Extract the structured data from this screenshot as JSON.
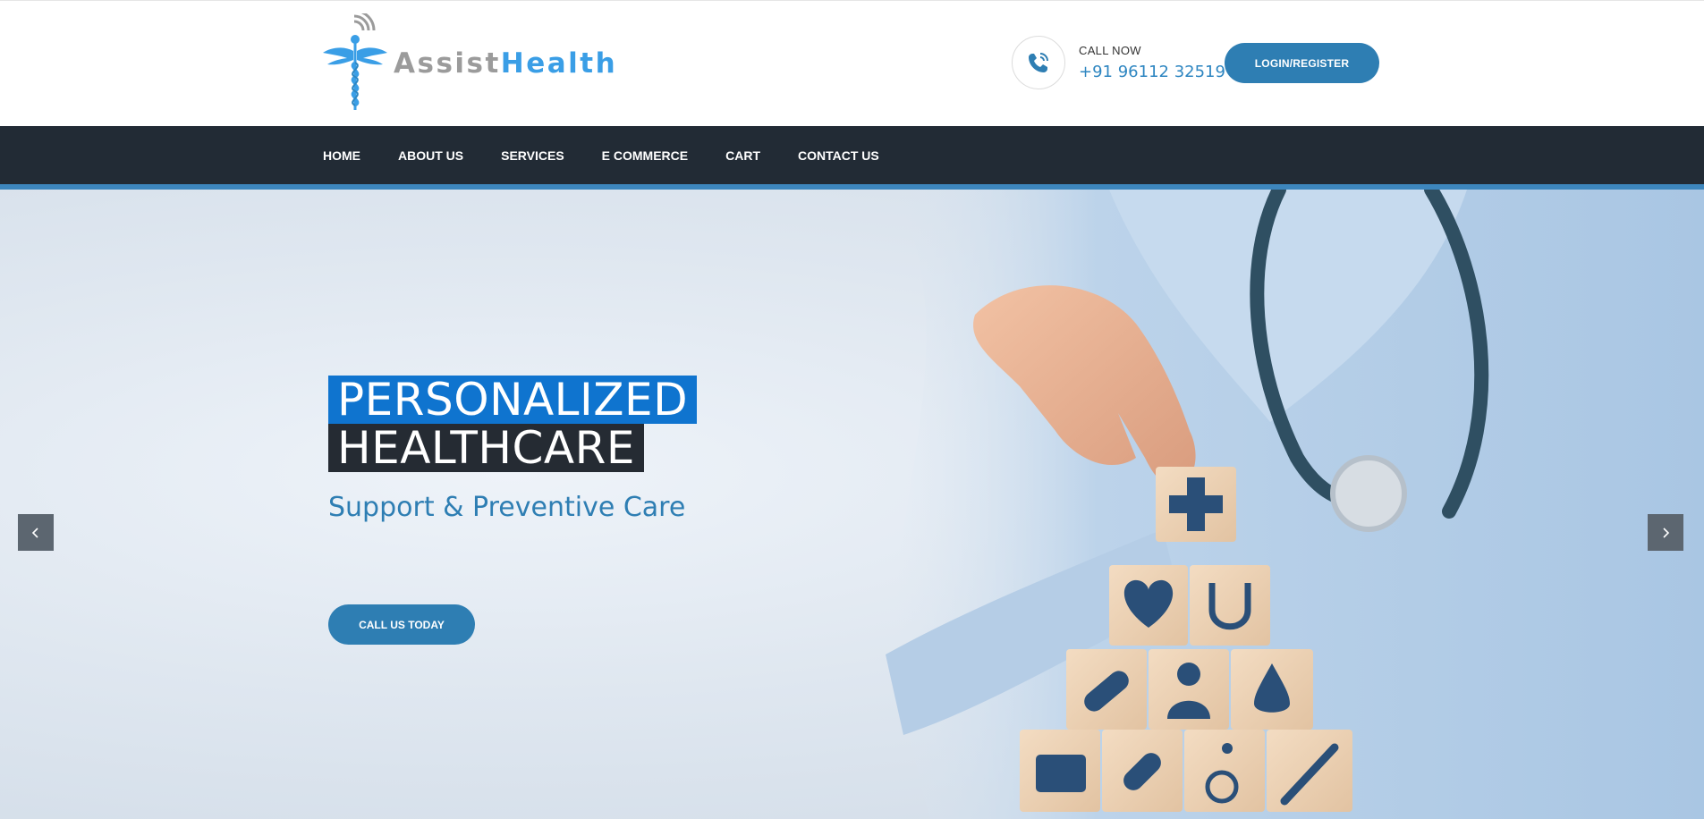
{
  "brand": {
    "name_part1": "Assist",
    "name_part2": "Health",
    "color_primary": "#3a9ee6",
    "color_secondary": "#9b9b9b"
  },
  "header": {
    "call_label": "CALL NOW",
    "phone": "+91 96112 32519",
    "login_label": "LOGIN/REGISTER",
    "phone_icon": "phone-icon"
  },
  "nav": {
    "items": [
      {
        "label": "HOME"
      },
      {
        "label": "ABOUT US"
      },
      {
        "label": "SERVICES"
      },
      {
        "label": "E COMMERCE"
      },
      {
        "label": "CART"
      },
      {
        "label": "CONTACT US"
      }
    ]
  },
  "hero": {
    "title_line1": "PERSONALIZED",
    "title_line2": "HEALTHCARE",
    "subtitle": "Support & Preventive Care",
    "cta_label": "CALL US TODAY",
    "prev_icon": "chevron-left-icon",
    "next_icon": "chevron-right-icon"
  },
  "colors": {
    "accent": "#2e7eb3",
    "nav_bg": "#222b35",
    "title_blue": "#0f74cf",
    "title_dark": "#252b33"
  }
}
